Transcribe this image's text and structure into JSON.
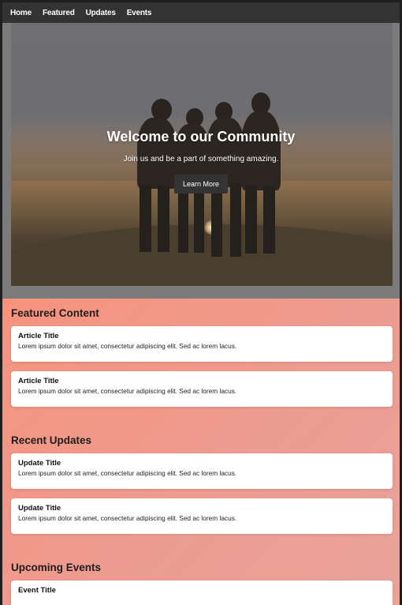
{
  "nav": {
    "items": [
      {
        "label": "Home"
      },
      {
        "label": "Featured"
      },
      {
        "label": "Updates"
      },
      {
        "label": "Events"
      }
    ]
  },
  "hero": {
    "title": "Welcome to our Community",
    "subtitle": "Join us and be a part of something amazing.",
    "button_label": "Learn More"
  },
  "sections": [
    {
      "title": "Featured Content",
      "cards": [
        {
          "title": "Article Title",
          "text": "Lorem ipsum dolor sit amet, consectetur adipiscing elit. Sed ac lorem lacus."
        },
        {
          "title": "Article Title",
          "text": "Lorem ipsum dolor sit amet, consectetur adipiscing elit. Sed ac lorem lacus."
        }
      ]
    },
    {
      "title": "Recent Updates",
      "cards": [
        {
          "title": "Update Title",
          "text": "Lorem ipsum dolor sit amet, consectetur adipiscing elit. Sed ac lorem lacus."
        },
        {
          "title": "Update Title",
          "text": "Lorem ipsum dolor sit amet, consectetur adipiscing elit. Sed ac lorem lacus."
        }
      ]
    },
    {
      "title": "Upcoming Events",
      "cards": [
        {
          "title": "Event Title",
          "text": ""
        }
      ]
    }
  ],
  "colors": {
    "nav_bg": "#333333",
    "page_gradient_start": "#f79e86",
    "page_gradient_end": "#e8a39b",
    "card_bg": "#ffffff",
    "button_bg": "#333333"
  }
}
